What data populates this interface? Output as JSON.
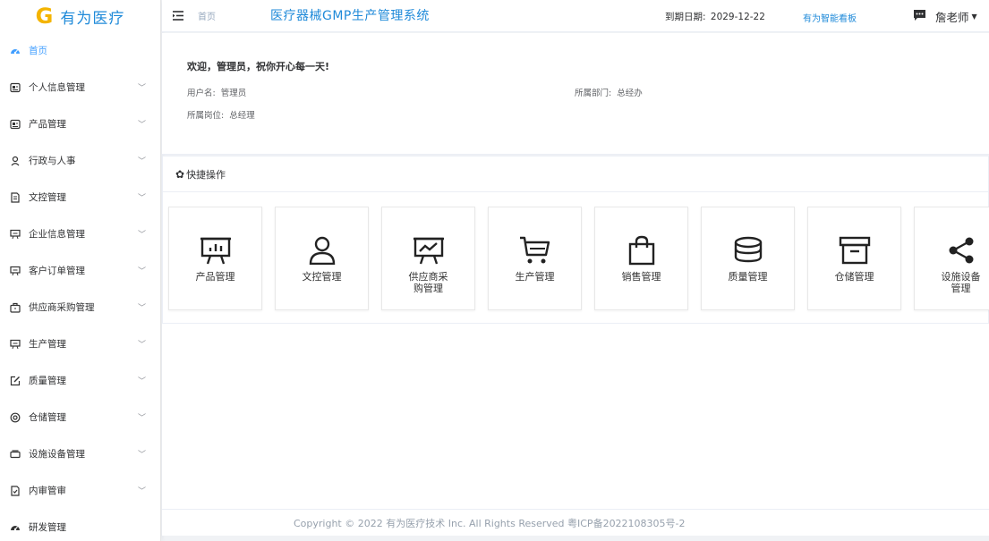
{
  "brand": {
    "logo_letter": "G",
    "name": "有为医疗"
  },
  "sidebar": {
    "items": [
      {
        "label": "首页",
        "icon": "dashboard-icon",
        "active": true
      },
      {
        "label": "个人信息管理",
        "icon": "profile-card-icon"
      },
      {
        "label": "产品管理",
        "icon": "profile-card-icon"
      },
      {
        "label": "行政与人事",
        "icon": "person-icon"
      },
      {
        "label": "文控管理",
        "icon": "document-icon"
      },
      {
        "label": "企业信息管理",
        "icon": "presentation-icon"
      },
      {
        "label": "客户订单管理",
        "icon": "presentation-icon"
      },
      {
        "label": "供应商采购管理",
        "icon": "briefcase-icon"
      },
      {
        "label": "生产管理",
        "icon": "presentation-icon"
      },
      {
        "label": "质量管理",
        "icon": "edit-icon"
      },
      {
        "label": "仓储管理",
        "icon": "lifebuoy-icon"
      },
      {
        "label": "设施设备管理",
        "icon": "tray-icon"
      },
      {
        "label": "内审管审",
        "icon": "document-check-icon"
      },
      {
        "label": "研发管理",
        "icon": "dashboard-icon"
      }
    ]
  },
  "header": {
    "breadcrumb": "首页",
    "system_title": "医疗器械GMP生产管理系统",
    "expire_label": "到期日期:",
    "expire_date": "2029-12-22",
    "dashboard_link": "有为智能看板",
    "user_name": "詹老师"
  },
  "welcome": {
    "greeting": "欢迎，管理员，祝你开心每一天!",
    "username_label": "用户名:",
    "username": "管理员",
    "department_label": "所属部门:",
    "department": "总经办",
    "position_label": "所属岗位:",
    "position": "总经理"
  },
  "quick": {
    "title": "快捷操作",
    "cards": [
      {
        "label": "产品管理",
        "icon": "presentation-chart-icon"
      },
      {
        "label": "文控管理",
        "icon": "user-icon"
      },
      {
        "label": "供应商采购管理",
        "icon": "line-chart-board-icon"
      },
      {
        "label": "生产管理",
        "icon": "cart-icon"
      },
      {
        "label": "销售管理",
        "icon": "shopping-bag-icon"
      },
      {
        "label": "质量管理",
        "icon": "coins-icon"
      },
      {
        "label": "仓储管理",
        "icon": "archive-box-icon"
      },
      {
        "label": "设施设备管理",
        "icon": "share-icon"
      }
    ]
  },
  "footer": {
    "copyright": "Copyright © 2022 有为医疗技术 Inc. All Rights Reserved 粤ICP备2022108305号-2"
  },
  "colors": {
    "accent": "#409eff",
    "brand_blue": "#1f8ad9",
    "logo_yellow": "#f4b400"
  }
}
